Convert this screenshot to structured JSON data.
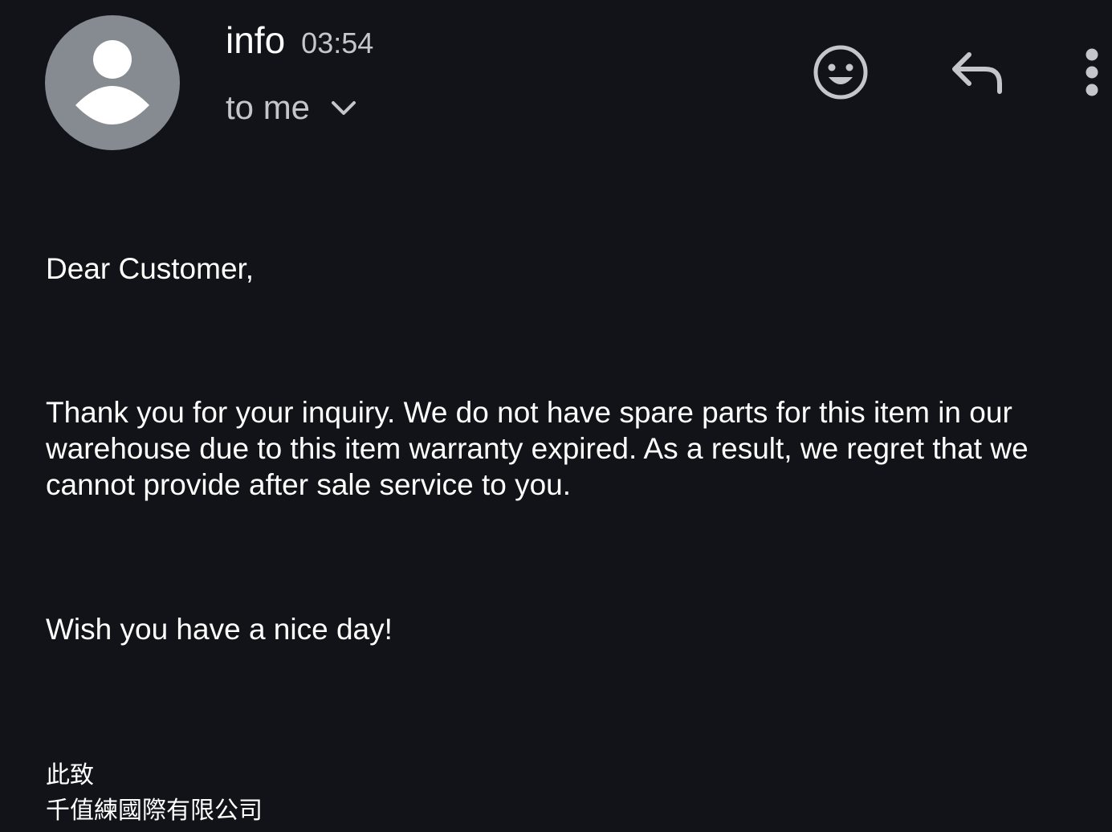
{
  "email": {
    "sender": {
      "name": "info",
      "time": "03:54"
    },
    "recipients_label": "to me",
    "actions": {
      "emoji_icon": "add-reaction-icon",
      "reply_icon": "reply-icon",
      "more_icon": "more-vert-icon"
    },
    "body": {
      "greeting": "Dear Customer,",
      "message": "Thank you for your inquiry. We do not have spare parts for this item in our warehouse due to this item warranty expired. As a result, we regret that we cannot provide after sale service to you.",
      "closing": "Wish you have a nice day!",
      "signature_line1": "此致",
      "signature_line2": "千值練國際有限公司"
    }
  },
  "colors": {
    "background": "#121318",
    "avatar": "#868a91",
    "text_primary": "#ffffff",
    "text_secondary": "#c4c6cc"
  }
}
